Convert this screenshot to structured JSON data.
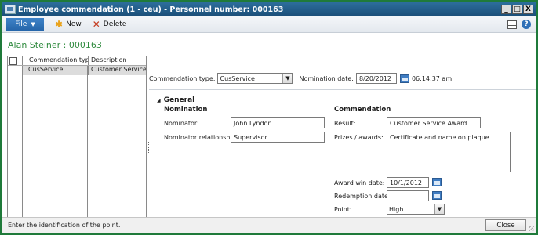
{
  "window": {
    "title": "Employee commendation (1 - ceu) - Personnel number: 000163",
    "controls": {
      "minimize": "_",
      "maximize": "□",
      "close": "X"
    }
  },
  "toolbar": {
    "file_label": "File",
    "new_label": "New",
    "delete_label": "Delete",
    "help_glyph": "?"
  },
  "person": {
    "name": "Alan Steiner : 000163"
  },
  "list": {
    "columns": [
      "Commendation type",
      "Description"
    ],
    "rows": [
      {
        "type": "CusService",
        "description": "Customer Service"
      }
    ]
  },
  "header": {
    "commendation_type_label": "Commendation type:",
    "commendation_type_value": "CusService",
    "nomination_date_label": "Nomination date:",
    "nomination_date_value": "8/20/2012",
    "nomination_time_value": "06:14:37 am"
  },
  "general": {
    "title": "General",
    "nomination": {
      "heading": "Nomination",
      "nominator_label": "Nominator:",
      "nominator_value": "John Lyndon",
      "relationship_label": "Nominator relationship:",
      "relationship_value": "Supervisor"
    },
    "commendation": {
      "heading": "Commendation",
      "result_label": "Result:",
      "result_value": "Customer Service Award",
      "prizes_label": "Prizes / awards:",
      "prizes_value": "Certificate and name on plaque",
      "award_win_date_label": "Award win date:",
      "award_win_date_value": "10/1/2012",
      "redemption_date_label": "Redemption date:",
      "redemption_date_value": "",
      "point_label": "Point:",
      "point_value": "High"
    }
  },
  "status": {
    "message": "Enter the identification of the point.",
    "close_label": "Close"
  },
  "icons": {
    "app": "form-window-icon",
    "new": "star-icon",
    "delete": "x-icon",
    "layout": "layout-icon",
    "help": "help-icon",
    "calendar": "calendar-icon"
  }
}
